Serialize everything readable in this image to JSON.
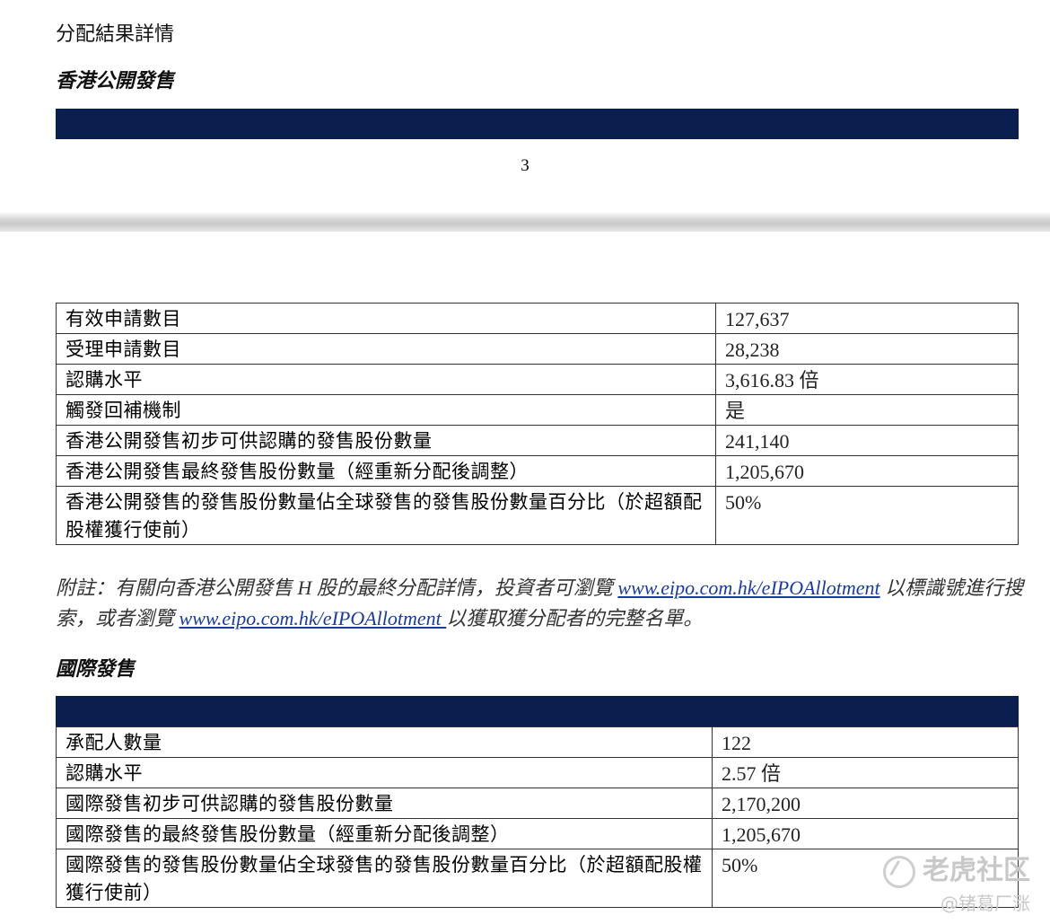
{
  "header": {
    "title": "分配結果詳情",
    "subtitle": "香港公開發售",
    "page_number": "3"
  },
  "hk_offer_table": [
    {
      "label": "有效申請數目",
      "value": "127,637"
    },
    {
      "label": "受理申請數目",
      "value": "28,238"
    },
    {
      "label": "認購水平",
      "value": "3,616.83 倍"
    },
    {
      "label": "觸發回補機制",
      "value": "是"
    },
    {
      "label": "香港公開發售初步可供認購的發售股份數量",
      "value": "241,140"
    },
    {
      "label": "香港公開發售最終發售股份數量（經重新分配後調整）",
      "value": "1,205,670"
    },
    {
      "label": "香港公開發售的發售股份數量佔全球發售的發售股份數量百分比（於超額配股權獲行使前）",
      "value": "50%"
    }
  ],
  "note": {
    "part1": "附註：有關向香港公開發售 H 股的最終分配詳情，投資者可瀏覽 ",
    "link1": "www.eipo.com.hk/eIPOAllotment",
    "part2": " 以標識號進行搜索，或者瀏覽 ",
    "link2": "www.eipo.com.hk/eIPOAllotment ",
    "part3": "以獲取獲分配者的完整名單。"
  },
  "intl_heading": "國際發售",
  "intl_table": [
    {
      "label": "承配人數量",
      "value": "122"
    },
    {
      "label": "認購水平",
      "value": "2.57 倍"
    },
    {
      "label": "國際發售初步可供認購的發售股份數量",
      "value": "2,170,200"
    },
    {
      "label": "國際發售的最終發售股份數量（經重新分配後調整）",
      "value": "1,205,670"
    },
    {
      "label": "國際發售的發售股份數量佔全球發售的發售股份數量百分比（於超額配股權獲行使前）",
      "value": "50%"
    }
  ],
  "watermark": {
    "brand": "老虎社区",
    "author": "@锗葛厂涨"
  },
  "colors": {
    "navy": "#0a1f4d",
    "link": "#1a3c9c"
  }
}
